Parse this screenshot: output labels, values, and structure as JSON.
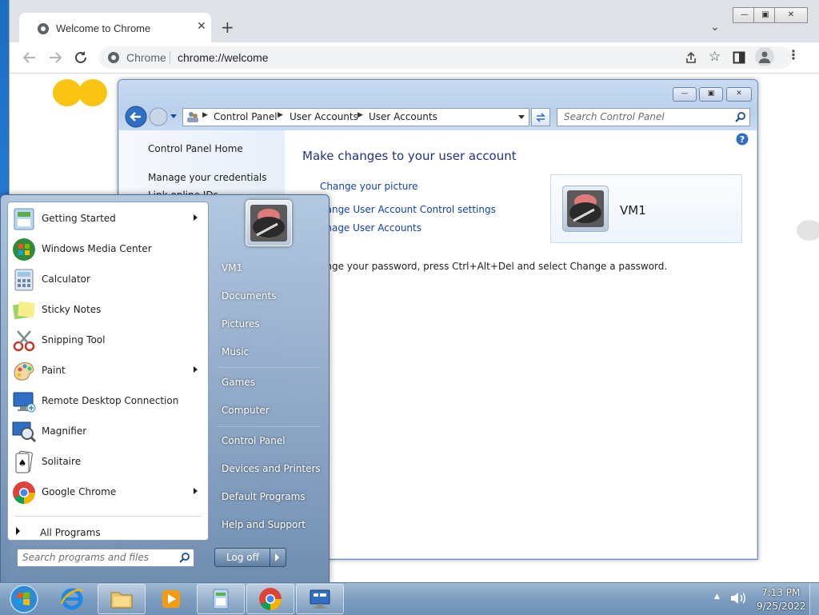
{
  "browser": {
    "tab_title": "Welcome to Chrome",
    "site_label": "Chrome",
    "url": "chrome://welcome"
  },
  "control_panel": {
    "breadcrumbs": [
      "Control Panel",
      "User Accounts",
      "User Accounts"
    ],
    "search_placeholder": "Search Control Panel",
    "nav": {
      "home": "Control Panel Home",
      "credentials": "Manage your credentials",
      "partial": "Link online IDs"
    },
    "heading": "Make changes to your user account",
    "links": {
      "change_picture": "Change your picture",
      "uac_settings": "hange User Account Control settings",
      "manage_accounts": "anage User Accounts"
    },
    "account_name": "VM1",
    "password_hint": "ange your password, press Ctrl+Alt+Del and select Change a password."
  },
  "start_menu": {
    "programs": [
      {
        "label": "Getting Started",
        "icon": "getting-started-icon",
        "has_submenu": true
      },
      {
        "label": "Windows Media Center",
        "icon": "media-center-icon",
        "has_submenu": false
      },
      {
        "label": "Calculator",
        "icon": "calculator-icon",
        "has_submenu": false
      },
      {
        "label": "Sticky Notes",
        "icon": "sticky-notes-icon",
        "has_submenu": false
      },
      {
        "label": "Snipping Tool",
        "icon": "snipping-tool-icon",
        "has_submenu": false
      },
      {
        "label": "Paint",
        "icon": "paint-icon",
        "has_submenu": true
      },
      {
        "label": "Remote Desktop Connection",
        "icon": "remote-desktop-icon",
        "has_submenu": false
      },
      {
        "label": "Magnifier",
        "icon": "magnifier-icon",
        "has_submenu": false
      },
      {
        "label": "Solitaire",
        "icon": "solitaire-icon",
        "has_submenu": false
      },
      {
        "label": "Google Chrome",
        "icon": "chrome-icon",
        "has_submenu": true
      }
    ],
    "all_programs": "All Programs",
    "search_placeholder": "Search programs and files",
    "right_items": {
      "user": "VM1",
      "documents": "Documents",
      "pictures": "Pictures",
      "music": "Music",
      "games": "Games",
      "computer": "Computer",
      "control_panel": "Control Panel",
      "devices": "Devices and Printers",
      "defaults": "Default Programs",
      "help": "Help and Support"
    },
    "logoff": "Log off"
  },
  "taskbar": {
    "time": "7:13 PM",
    "date": "9/25/2022"
  },
  "colors": {
    "link": "#0f3fa8",
    "heading": "#1e3287",
    "desktop": "#2b82d9"
  }
}
